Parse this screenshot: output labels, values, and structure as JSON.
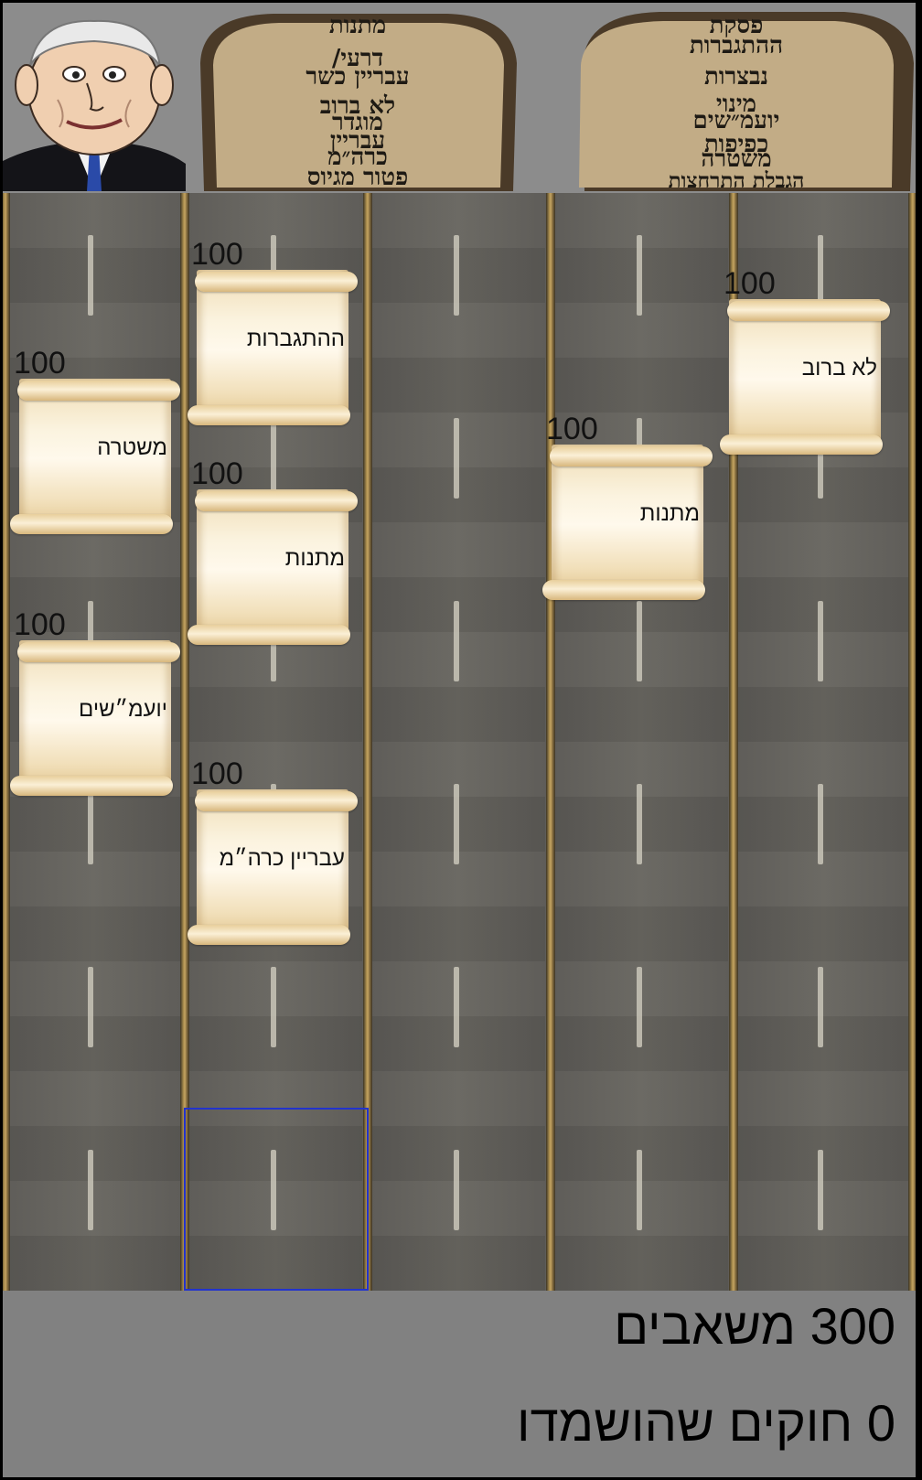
{
  "header": {
    "tablet_gifts": [
      "מתנות",
      "דרעי/",
      "עבריין כשר",
      "לא ברוב",
      "מוגדר",
      "עבריין",
      "כרה״מ",
      "פטור מגיוס"
    ],
    "tablet_laws": [
      "פסקת",
      "ההתגברות",
      "נבצרות",
      "מינוי",
      "יועמ״שים",
      "כפיפות",
      "משטרה",
      "הגבלת התרחצות"
    ]
  },
  "board": {
    "scrolls": [
      {
        "points": "100",
        "law": "ההתגברות"
      },
      {
        "points": "100",
        "law": "משטרה"
      },
      {
        "points": "100",
        "law": "מתנות"
      },
      {
        "points": "100",
        "law": "יועמ״שים"
      },
      {
        "points": "100",
        "law": "עבריין כרה״מ"
      },
      {
        "points": "100",
        "law": "מתנות"
      },
      {
        "points": "100",
        "law": "לא ברוב"
      }
    ]
  },
  "footer": {
    "resources": "300 משאבים",
    "laws_destroyed": "0 חוקים שהושמדו"
  },
  "colors": {
    "selector": "#2233cc",
    "road": "#5e5c58",
    "panel": "#8a8a8a"
  },
  "icons": [
    "caricature-portrait",
    "stone-tablet-gifts",
    "stone-tablet-laws",
    "law-scroll"
  ]
}
